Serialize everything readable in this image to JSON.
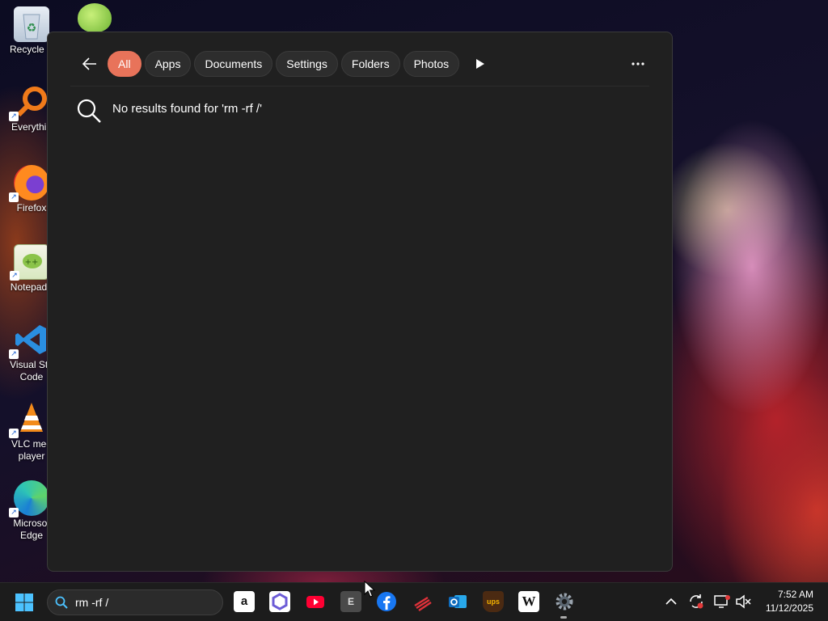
{
  "desktop": {
    "icons": [
      {
        "name": "Recycle Bin",
        "label": "Recycle B"
      },
      {
        "name": "Everything",
        "label": "Everythin"
      },
      {
        "name": "Firefox",
        "label": "Firefox"
      },
      {
        "name": "Notepad++",
        "label": "Notepad+"
      },
      {
        "name": "Visual Studio Code",
        "label": "Visual Stu",
        "label2": "Code"
      },
      {
        "name": "VLC media player",
        "label": "VLC med",
        "label2": "player"
      },
      {
        "name": "Microsoft Edge",
        "label": "Microsof",
        "label2": "Edge"
      }
    ]
  },
  "search_panel": {
    "filters": [
      "All",
      "Apps",
      "Documents",
      "Settings",
      "Folders",
      "Photos"
    ],
    "active_filter": "All",
    "no_results_text": "No results found for 'rm -rf /'",
    "accent_color": "#e8735a"
  },
  "taskbar": {
    "search_value": "rm -rf /",
    "pinned_apps": [
      "Amazon",
      "Copilot",
      "YouTube",
      "E",
      "Facebook",
      "Stream",
      "Outlook",
      "UPS",
      "Wikipedia",
      "Settings"
    ],
    "app_glyphs": {
      "amazon": "a",
      "epic": "E",
      "wikipedia": "W",
      "ups": "ups"
    },
    "clock": {
      "time": "7:52 AM",
      "date": "11/12/2025"
    }
  }
}
